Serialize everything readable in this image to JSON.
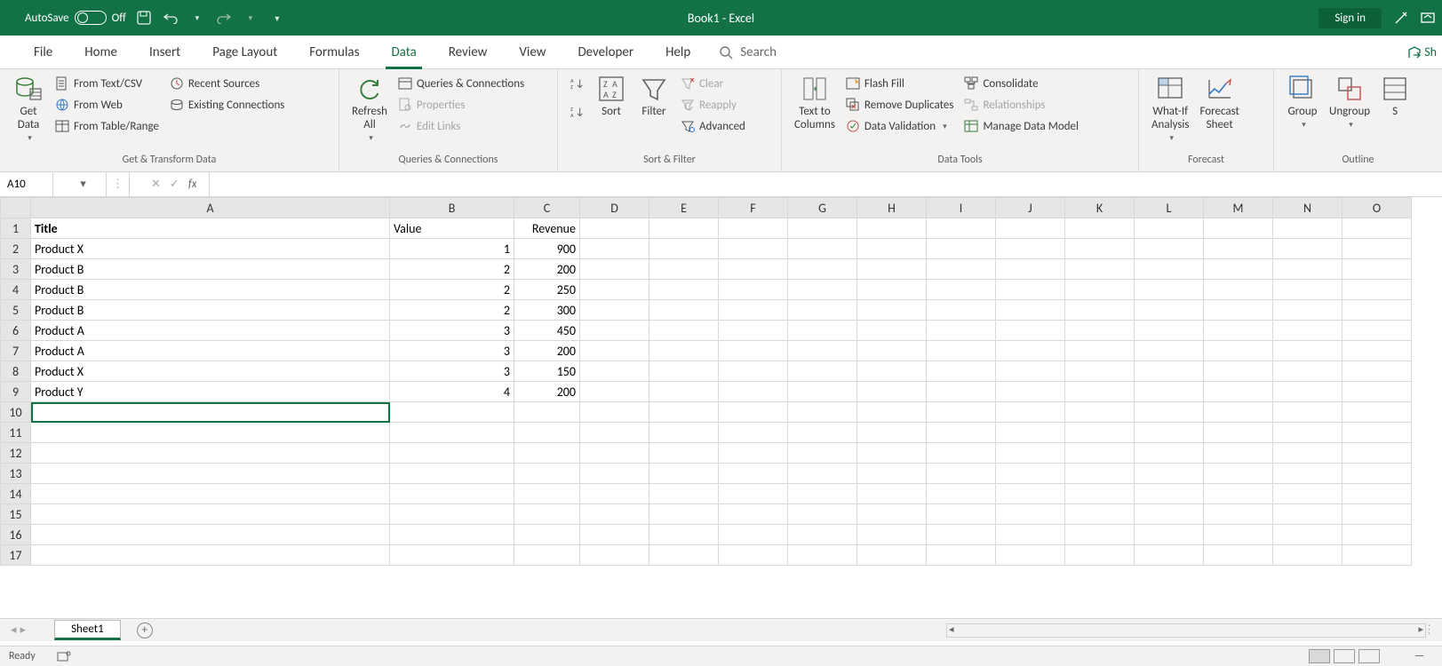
{
  "titlebar": {
    "autosave_label": "AutoSave",
    "autosave_state": "Off",
    "app_title": "Book1  -  Excel",
    "signin": "Sign in"
  },
  "tabs": {
    "file": "File",
    "home": "Home",
    "insert": "Insert",
    "pagelayout": "Page Layout",
    "formulas": "Formulas",
    "data": "Data",
    "review": "Review",
    "view": "View",
    "developer": "Developer",
    "help": "Help",
    "search": "Search",
    "share": "Sh"
  },
  "ribbon": {
    "g1": {
      "label": "Get & Transform Data",
      "get_data": "Get\nData",
      "from_text_csv": "From Text/CSV",
      "from_web": "From Web",
      "from_table": "From Table/Range",
      "recent": "Recent Sources",
      "existing": "Existing Connections"
    },
    "g2": {
      "label": "Queries & Connections",
      "refresh": "Refresh\nAll",
      "qc": "Queries & Connections",
      "props": "Properties",
      "edit_links": "Edit Links"
    },
    "g3": {
      "label": "Sort & Filter",
      "sort": "Sort",
      "filter": "Filter",
      "clear": "Clear",
      "reapply": "Reapply",
      "advanced": "Advanced"
    },
    "g4": {
      "label": "Data Tools",
      "text_to_cols": "Text to\nColumns",
      "flash_fill": "Flash Fill",
      "remove_dup": "Remove Duplicates",
      "data_val": "Data Validation",
      "consolidate": "Consolidate",
      "relationships": "Relationships",
      "mdm": "Manage Data Model"
    },
    "g5": {
      "label": "Forecast",
      "whatif": "What-If\nAnalysis",
      "forecast": "Forecast\nSheet"
    },
    "g6": {
      "label": "Outline",
      "group": "Group",
      "ungroup": "Ungroup",
      "subtotal": "S"
    }
  },
  "fxbar": {
    "namebox": "A10"
  },
  "sheet": {
    "columns": [
      "A",
      "B",
      "C",
      "D",
      "E",
      "F",
      "G",
      "H",
      "I",
      "J",
      "K",
      "L",
      "M",
      "N",
      "O"
    ],
    "headers": {
      "A": "Title",
      "B": "Value",
      "C": "Revenue"
    },
    "rows": [
      {
        "A": "Product X",
        "B": 1,
        "C": 900
      },
      {
        "A": "Product B",
        "B": 2,
        "C": 200
      },
      {
        "A": "Product B",
        "B": 2,
        "C": 250
      },
      {
        "A": "Product B",
        "B": 2,
        "C": 300
      },
      {
        "A": "Product A",
        "B": 3,
        "C": 450
      },
      {
        "A": "Product A",
        "B": 3,
        "C": 200
      },
      {
        "A": "Product X",
        "B": 3,
        "C": 150
      },
      {
        "A": "Product Y",
        "B": 4,
        "C": 200
      }
    ],
    "active_cell": "A10",
    "visible_rows": 17
  },
  "sheetbar": {
    "sheet1": "Sheet1"
  },
  "status": {
    "ready": "Ready"
  }
}
